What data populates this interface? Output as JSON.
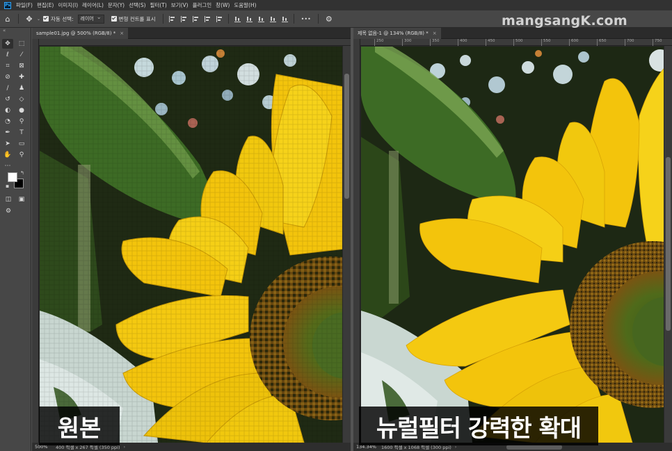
{
  "menubar": {
    "logo": "Ps",
    "items": [
      "파일(F)",
      "편집(E)",
      "이미지(I)",
      "레이어(L)",
      "문자(Y)",
      "선택(S)",
      "필터(T)",
      "보기(V)",
      "플러그인",
      "창(W)",
      "도움말(H)"
    ]
  },
  "options": {
    "auto_select_label": "자동 선택:",
    "auto_select_value": "레이어",
    "transform_label": "변형 컨트롤 표시",
    "more_label": "•••"
  },
  "watermark": "mangsangK.com",
  "left_doc": {
    "tab_title": "sample01.jpg @ 500% (RGB/8) *",
    "tab_close": "×",
    "zoom": "500%",
    "status_info": "400 픽셀 x 267 픽셀 (350 ppi)",
    "caption": "원본",
    "ruler_ticks": []
  },
  "right_doc": {
    "tab_title": "제목 없음-1 @ 134% (RGB/8) *",
    "tab_close": "×",
    "zoom": "134.34%",
    "status_info": "1600 픽셀 x 1068 픽셀 (300 ppi)",
    "caption": "뉴럴필터 강력한 확대",
    "ruler_ticks": [
      "250",
      "300",
      "350",
      "400",
      "450",
      "500",
      "550",
      "600",
      "650",
      "700",
      "750"
    ]
  },
  "colors": {
    "foreground": "#ffffff",
    "background": "#000000",
    "accent": "#31a8ff"
  }
}
